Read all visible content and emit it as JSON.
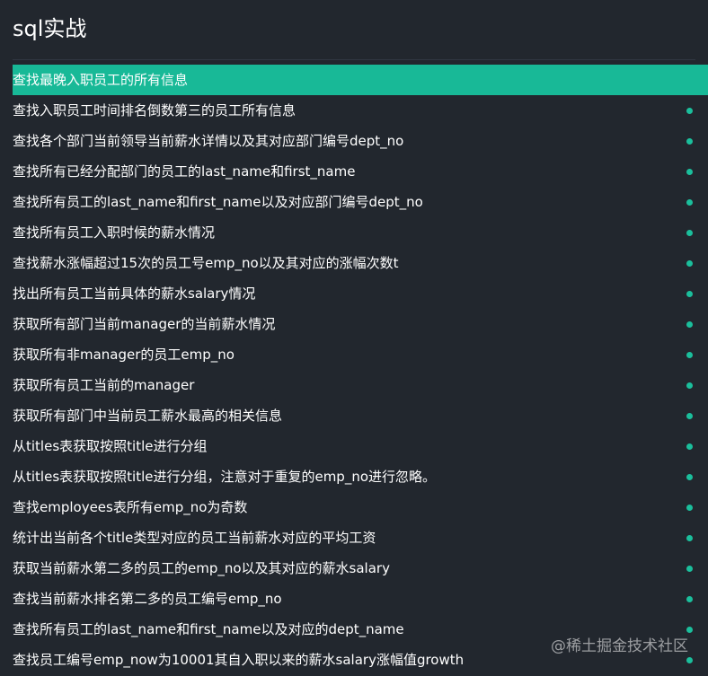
{
  "header": {
    "title": "sql实战"
  },
  "items": [
    {
      "label": "查找最晚入职员工的所有信息",
      "active": true
    },
    {
      "label": "查找入职员工时间排名倒数第三的员工所有信息",
      "active": false
    },
    {
      "label": "查找各个部门当前领导当前薪水详情以及其对应部门编号dept_no",
      "active": false
    },
    {
      "label": "查找所有已经分配部门的员工的last_name和first_name",
      "active": false
    },
    {
      "label": "查找所有员工的last_name和first_name以及对应部门编号dept_no",
      "active": false
    },
    {
      "label": "查找所有员工入职时候的薪水情况",
      "active": false
    },
    {
      "label": "查找薪水涨幅超过15次的员工号emp_no以及其对应的涨幅次数t",
      "active": false
    },
    {
      "label": "找出所有员工当前具体的薪水salary情况",
      "active": false
    },
    {
      "label": "获取所有部门当前manager的当前薪水情况",
      "active": false
    },
    {
      "label": "获取所有非manager的员工emp_no",
      "active": false
    },
    {
      "label": "获取所有员工当前的manager",
      "active": false
    },
    {
      "label": "获取所有部门中当前员工薪水最高的相关信息",
      "active": false
    },
    {
      "label": "从titles表获取按照title进行分组",
      "active": false
    },
    {
      "label": "从titles表获取按照title进行分组，注意对于重复的emp_no进行忽略。",
      "active": false
    },
    {
      "label": "查找employees表所有emp_no为奇数",
      "active": false
    },
    {
      "label": "统计出当前各个title类型对应的员工当前薪水对应的平均工资",
      "active": false
    },
    {
      "label": "获取当前薪水第二多的员工的emp_no以及其对应的薪水salary",
      "active": false
    },
    {
      "label": "查找当前薪水排名第二多的员工编号emp_no",
      "active": false
    },
    {
      "label": "查找所有员工的last_name和first_name以及对应的dept_name",
      "active": false
    },
    {
      "label": "查找员工编号emp_now为10001其自入职以来的薪水salary涨幅值growth",
      "active": false
    }
  ],
  "watermark": "@稀土掘金技术社区",
  "colors": {
    "background": "#22272e",
    "accent": "#18b997",
    "dot": "#1bbf9c"
  }
}
